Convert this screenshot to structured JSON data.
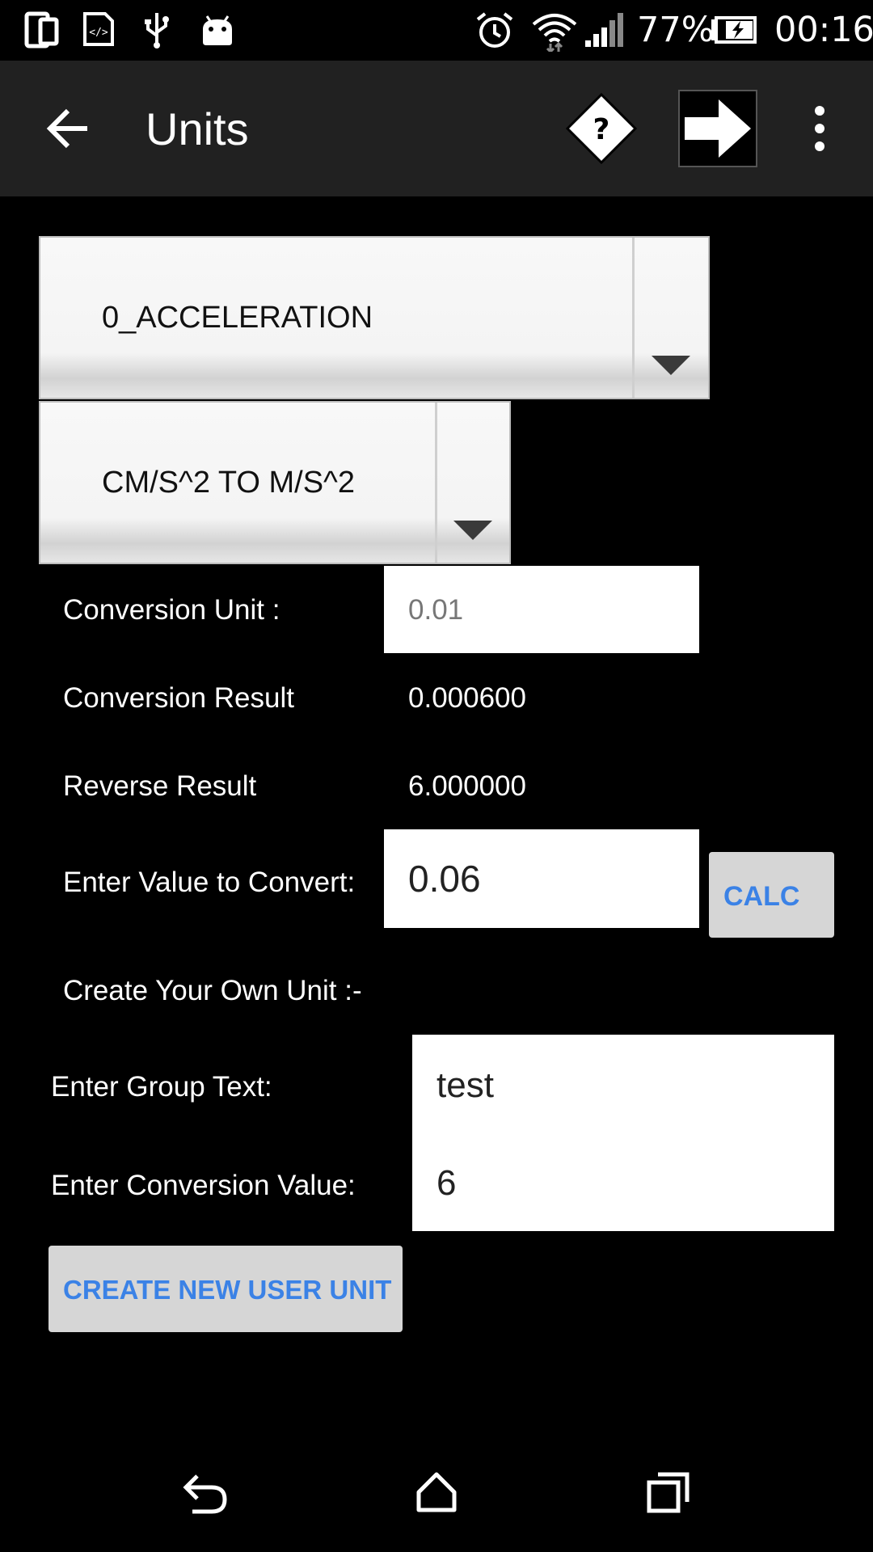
{
  "status_bar": {
    "battery": "77%",
    "time": "00:16",
    "icons": [
      "phone-tablet-icon",
      "code-icon",
      "usb-icon",
      "android-icon",
      "alarm-icon",
      "wifi-icon",
      "signal-icon",
      "battery-charging-icon"
    ]
  },
  "action_bar": {
    "title": "Units",
    "icons": [
      "back-arrow-icon",
      "help-diamond-icon",
      "next-arrow-icon",
      "overflow-menu-icon"
    ]
  },
  "spinners": {
    "group": "0_ACCELERATION",
    "conversion": "CM/S^2 TO  M/S^2"
  },
  "conversion": {
    "unit_label": "Conversion Unit :",
    "unit_value": "0.01",
    "result_label": "Conversion Result",
    "result_value": "0.000600",
    "reverse_label": "Reverse Result",
    "reverse_value": "6.000000",
    "enter_label": "Enter Value to Convert:",
    "enter_value": "0.06",
    "calc_button": "CALC"
  },
  "user_unit": {
    "section_label": "Create Your Own Unit :-",
    "group_label": "Enter Group Text:",
    "group_value": "test",
    "value_label": "Enter Conversion Value:",
    "value_value": "6",
    "create_button": "CREATE NEW USER UNIT"
  },
  "nav_bar": {
    "icons": [
      "back-icon",
      "home-icon",
      "recents-icon"
    ]
  },
  "colors": {
    "background": "#000000",
    "action_bar": "#212121",
    "button_text": "#3b82e6",
    "button_bg": "#d6d6d6"
  }
}
